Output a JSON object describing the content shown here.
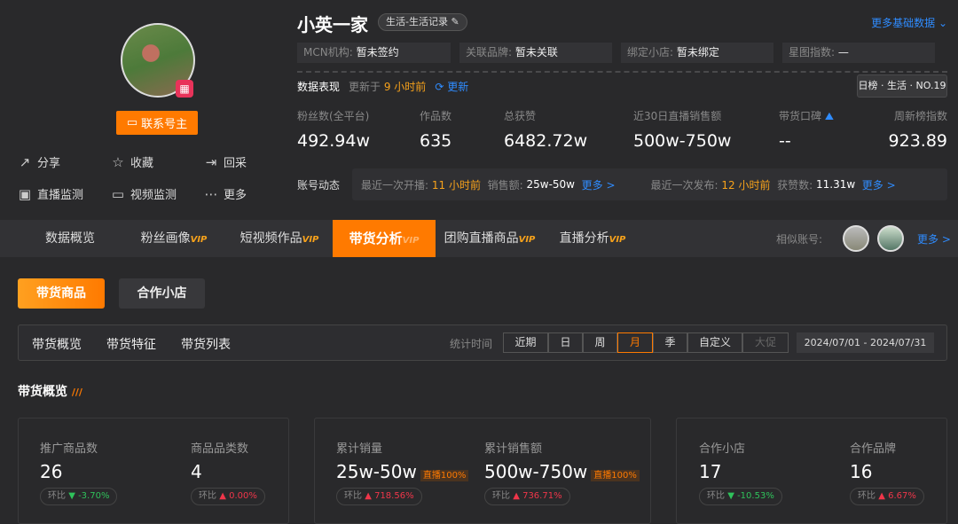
{
  "profile": {
    "name": "小英一家",
    "category": "生活-生活记录",
    "contact_label": "联系号主",
    "actions": [
      {
        "icon": "share-icon",
        "label": "分享"
      },
      {
        "icon": "star-icon",
        "label": "收藏"
      },
      {
        "icon": "recollect-icon",
        "label": "回采"
      },
      {
        "icon": "live-monitor-icon",
        "label": "直播监测"
      },
      {
        "icon": "video-monitor-icon",
        "label": "视频监测"
      },
      {
        "icon": "more-icon",
        "label": "更多"
      }
    ]
  },
  "more_basic": "更多基础数据",
  "info": [
    {
      "k": "MCN机构:",
      "v": "暂未签约"
    },
    {
      "k": "关联品牌:",
      "v": "暂未关联"
    },
    {
      "k": "绑定小店:",
      "v": "暂未绑定"
    },
    {
      "k": "星图指数:",
      "v": "—"
    }
  ],
  "perf": {
    "title": "数据表现",
    "updated_prefix": "更新于",
    "updated": "9 小时前",
    "refresh": "更新",
    "rank": "日榜 · 生活 · NO.19"
  },
  "stats": [
    {
      "label": "粉丝数(全平台)",
      "value": "492.94w"
    },
    {
      "label": "作品数",
      "value": "635"
    },
    {
      "label": "总获赞",
      "value": "6482.72w"
    },
    {
      "label": "近30日直播销售额",
      "value": "500w-750w"
    },
    {
      "label": "带货口碑",
      "value": "--"
    },
    {
      "label": "周新榜指数",
      "value": "923.89"
    }
  ],
  "dynamics": {
    "title": "账号动态",
    "live_label": "最近一次开播:",
    "live_time": "11 小时前",
    "sales_label": "销售额:",
    "sales": "25w-50w",
    "more": "更多 >",
    "post_label": "最近一次发布:",
    "post_time": "12 小时前",
    "likes_label": "获赞数:",
    "likes": "11.31w"
  },
  "tabs": [
    {
      "label": "数据概览",
      "vip": ""
    },
    {
      "label": "粉丝画像",
      "vip": "VIP"
    },
    {
      "label": "短视频作品",
      "vip": "VIP"
    },
    {
      "label": "带货分析",
      "vip": "VIP"
    },
    {
      "label": "团购直播商品",
      "vip": "VIP"
    },
    {
      "label": "直播分析",
      "vip": "VIP"
    }
  ],
  "similar": {
    "label": "相似账号:",
    "more": "更多 >"
  },
  "sub": {
    "goods": "带货商品",
    "shop": "合作小店"
  },
  "subtabs": [
    "带货概览",
    "带货特征",
    "带货列表"
  ],
  "time": {
    "label": "统计时间",
    "options": [
      "近期",
      "日",
      "周",
      "月",
      "季",
      "自定义",
      "大促"
    ],
    "selected": "月",
    "range": "2024/07/01 - 2024/07/31"
  },
  "section": "带货概览",
  "metrics": [
    {
      "label": "推广商品数",
      "value": "26",
      "cmp": "环比",
      "dir": "down",
      "change": "-3.70%"
    },
    {
      "label": "商品品类数",
      "value": "4",
      "cmp": "环比",
      "dir": "up",
      "change": "0.00%"
    },
    {
      "label": "累计销量",
      "value": "25w-50w",
      "badge": "直播100%",
      "cmp": "环比",
      "dir": "up",
      "change": "718.56%"
    },
    {
      "label": "累计销售额",
      "value": "500w-750w",
      "badge": "直播100%",
      "cmp": "环比",
      "dir": "up",
      "change": "736.71%"
    },
    {
      "label": "合作小店",
      "value": "17",
      "cmp": "环比",
      "dir": "down",
      "change": "-10.53%"
    },
    {
      "label": "合作品牌",
      "value": "16",
      "cmp": "环比",
      "dir": "up",
      "change": "6.67%"
    }
  ]
}
